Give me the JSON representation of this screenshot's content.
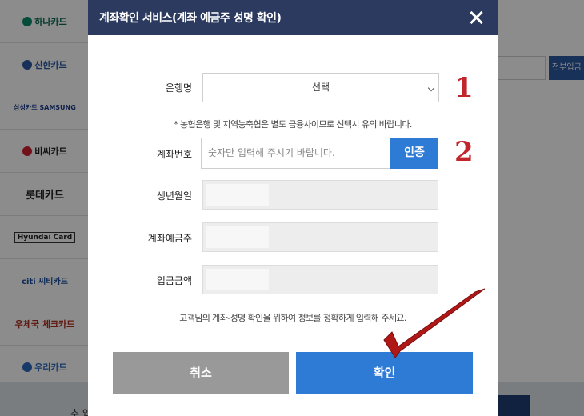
{
  "background": {
    "cards": [
      {
        "label": "하나카드",
        "icon": "hana-icon",
        "color": "#0a8a6a"
      },
      {
        "label": "신한카드",
        "icon": "shinhan-icon",
        "color": "#2a5aa0"
      },
      {
        "label": "삼성카드 SAMSUNG",
        "icon": "",
        "color": "#1a3a8a"
      },
      {
        "label": "비씨카드",
        "icon": "bc-icon",
        "color": "#d02030"
      },
      {
        "label": "롯데카드",
        "icon": "",
        "color": "#333333"
      },
      {
        "label": "Hyundai Card",
        "icon": "",
        "color": "#222222"
      },
      {
        "label": "citi 씨티카드",
        "icon": "",
        "color": "#1a4fa0"
      },
      {
        "label": "우체국 체크카드",
        "icon": "",
        "color": "#b03020"
      },
      {
        "label": "우리카드",
        "icon": "woori-icon",
        "color": "#2a6ac0"
      }
    ],
    "right_button": "전부입금",
    "bottom_text": "추 입"
  },
  "modal": {
    "title": "계좌확인 서비스(계좌 예금주 성명 확인)",
    "bank_label": "은행명",
    "bank_select_value": "선택",
    "notice": "* 농협은행 및 지역농축협은 별도 금융사이므로 선택시 유의 바랍니다.",
    "account_label": "계좌번호",
    "account_placeholder": "숫자만 입력해 주시기 바랍니다.",
    "auth_button": "인증",
    "birth_label": "생년월일",
    "holder_label": "계좌예금주",
    "amount_label": "입금금액",
    "footer_notice": "고객님의 계좌-성명 확인을 위하여 정보를 정확하게 입력해 주세요.",
    "cancel_button": "취소",
    "confirm_button": "확인"
  },
  "annotations": {
    "step1": "1",
    "step2": "2"
  }
}
